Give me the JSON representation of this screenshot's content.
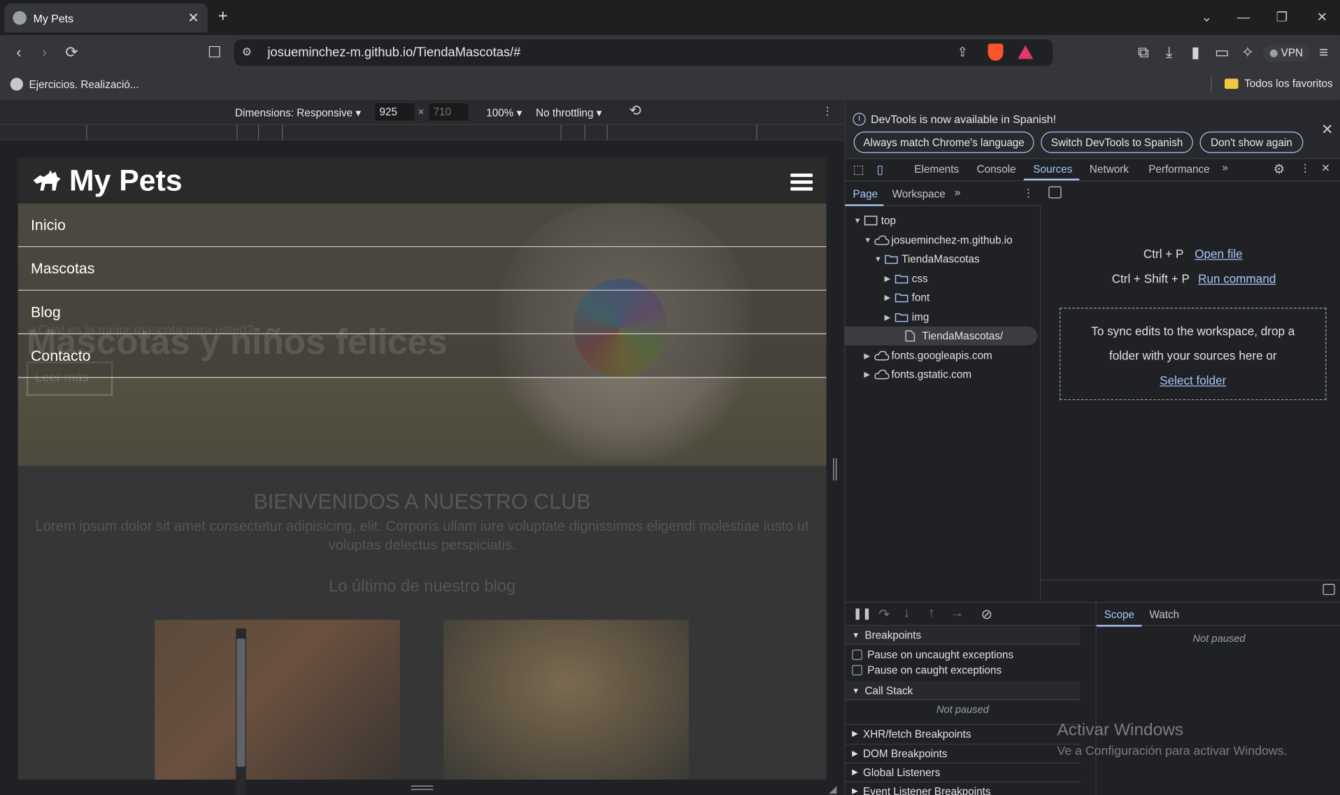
{
  "browser": {
    "tab_title": "My Pets",
    "url": "josueminchez-m.github.io/TiendaMascotas/#",
    "bookmark_left": "Ejercicios. Realizació...",
    "bookmark_right": "Todos los favoritos",
    "vpn": "VPN"
  },
  "device_toolbar": {
    "dimensions": "Dimensions: Responsive",
    "width": "925",
    "height_placeholder": "710",
    "times": "×",
    "zoom": "100%",
    "throttle": "No throttling"
  },
  "site": {
    "brand": "My Pets",
    "nav": [
      "Inicio",
      "Mascotas",
      "Blog",
      "Contacto"
    ],
    "hero_title": "Mascotas y niños felices",
    "hero_subtitle": "¿Cuál es la mejor mascota para usted?",
    "hero_button": "Leer más",
    "welcome": "BIENVENIDOS A NUESTRO CLUB",
    "lorem": "Lorem ipsum dolor sit amet consectetur adipisicing, elit. Corporis ullam iure voluptate dignissimos eligendi molestiae iusto ut voluptas delectus perspiciatis.",
    "blog_title": "Lo último de nuestro blog"
  },
  "devtools": {
    "info_text": "DevTools is now available in Spanish!",
    "info_buttons": [
      "Always match Chrome's language",
      "Switch DevTools to Spanish",
      "Don't show again"
    ],
    "tabs": [
      "Elements",
      "Console",
      "Sources",
      "Network",
      "Performance"
    ],
    "active_tab": "Sources",
    "subtabs": [
      "Page",
      "Workspace"
    ],
    "tree": {
      "top": "top",
      "domain": "josueminchez-m.github.io",
      "folder": "TiendaMascotas",
      "css": "css",
      "font": "font",
      "img": "img",
      "file": "TiendaMascotas/",
      "gapis": "fonts.googleapis.com",
      "gstatic": "fonts.gstatic.com"
    },
    "shortcut1_keys": "Ctrl + P",
    "shortcut1_action": "Open file",
    "shortcut2_keys": "Ctrl + Shift + P",
    "shortcut2_action": "Run command",
    "drop_line1": "To sync edits to the workspace, drop a",
    "drop_line2": "folder with your sources here or",
    "drop_link": "Select folder",
    "scope_tab": "Scope",
    "watch_tab": "Watch",
    "not_paused": "Not paused",
    "breakpoints": "Breakpoints",
    "pause_uncaught": "Pause on uncaught exceptions",
    "pause_caught": "Pause on caught exceptions",
    "call_stack": "Call Stack",
    "xhr": "XHR/fetch Breakpoints",
    "dom": "DOM Breakpoints",
    "global": "Global Listeners",
    "event": "Event Listener Breakpoints"
  },
  "os": {
    "activate_title": "Activar Windows",
    "activate_sub": "Ve a Configuración para activar Windows."
  },
  "colors": {
    "accent": "#a8c7fa",
    "toolbar": "#35363a",
    "panel": "#202124"
  }
}
